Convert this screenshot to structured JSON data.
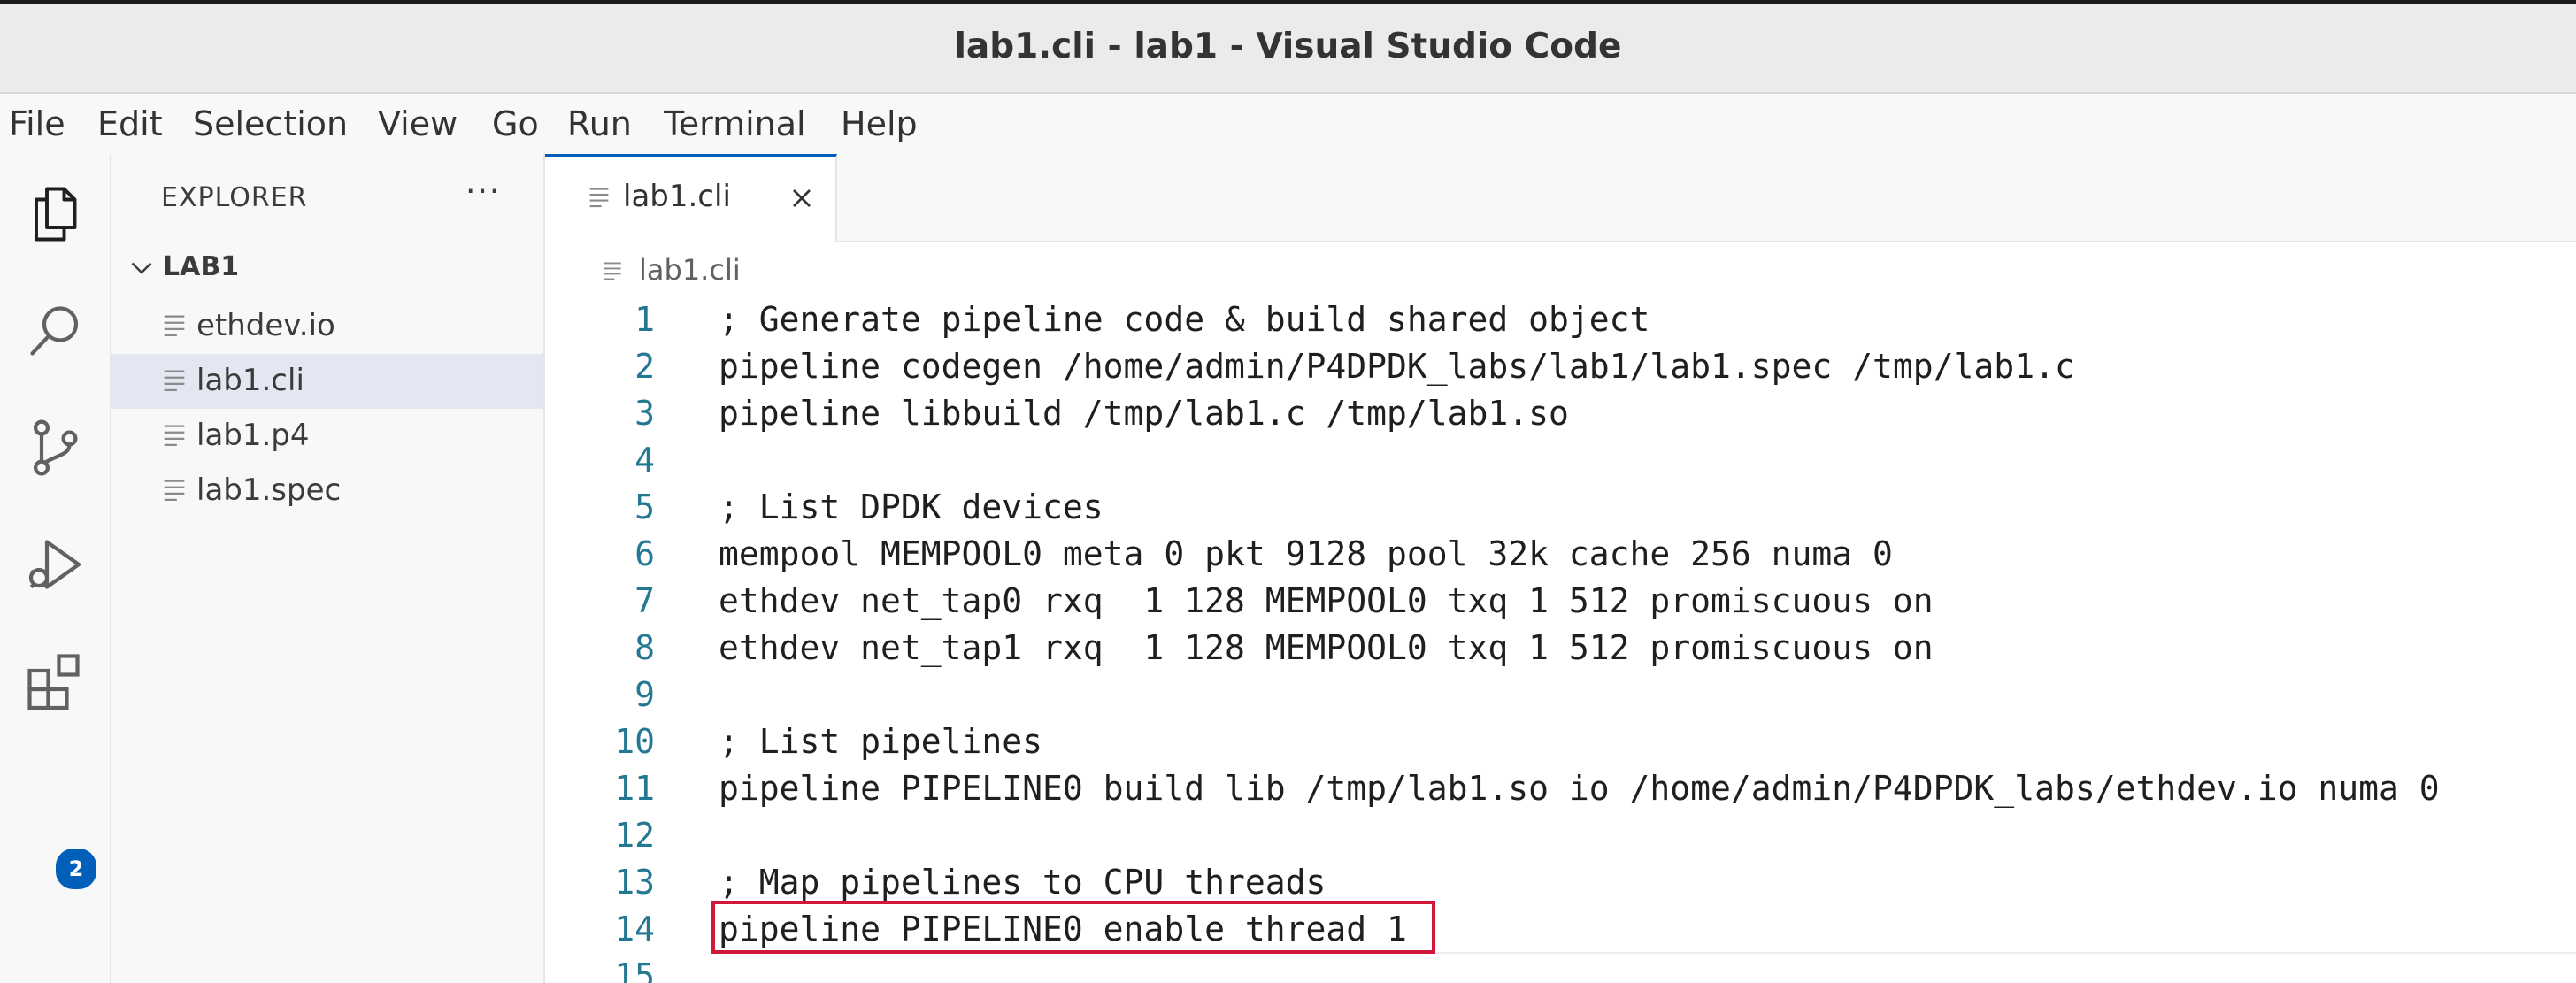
{
  "window": {
    "title": "lab1.cli - lab1 - Visual Studio Code"
  },
  "menu": [
    "File",
    "Edit",
    "Selection",
    "View",
    "Go",
    "Run",
    "Terminal",
    "Help"
  ],
  "activity_bar": {
    "icons": [
      "explorer-icon",
      "search-icon",
      "source-control-icon",
      "run-debug-icon",
      "extensions-icon"
    ],
    "extensions_badge": "2"
  },
  "sidebar": {
    "title": "EXPLORER",
    "more": "···",
    "folder": "LAB1",
    "files": [
      {
        "name": "ethdev.io",
        "active": false
      },
      {
        "name": "lab1.cli",
        "active": true
      },
      {
        "name": "lab1.p4",
        "active": false
      },
      {
        "name": "lab1.spec",
        "active": false
      }
    ]
  },
  "tabs": [
    {
      "label": "lab1.cli",
      "active": true
    }
  ],
  "breadcrumb": "lab1.cli",
  "editor": {
    "lines": [
      {
        "n": "1",
        "text": "; Generate pipeline code & build shared object"
      },
      {
        "n": "2",
        "text": "pipeline codegen /home/admin/P4DPDK_labs/lab1/lab1.spec /tmp/lab1.c"
      },
      {
        "n": "3",
        "text": "pipeline libbuild /tmp/lab1.c /tmp/lab1.so"
      },
      {
        "n": "4",
        "text": ""
      },
      {
        "n": "5",
        "text": "; List DPDK devices"
      },
      {
        "n": "6",
        "text": "mempool MEMPOOL0 meta 0 pkt 9128 pool 32k cache 256 numa 0"
      },
      {
        "n": "7",
        "text": "ethdev net_tap0 rxq  1 128 MEMPOOL0 txq 1 512 promiscuous on"
      },
      {
        "n": "8",
        "text": "ethdev net_tap1 rxq  1 128 MEMPOOL0 txq 1 512 promiscuous on"
      },
      {
        "n": "9",
        "text": ""
      },
      {
        "n": "10",
        "text": "; List pipelines"
      },
      {
        "n": "11",
        "text": "pipeline PIPELINE0 build lib /tmp/lab1.so io /home/admin/P4DPDK_labs/ethdev.io numa 0"
      },
      {
        "n": "12",
        "text": ""
      },
      {
        "n": "13",
        "text": "; Map pipelines to CPU threads"
      },
      {
        "n": "14",
        "text": "pipeline PIPELINE0 enable thread 1"
      },
      {
        "n": "15",
        "text": ""
      }
    ],
    "highlighted_line": "14"
  },
  "colors": {
    "accent": "#005fb8",
    "highlight_box": "#d0193a",
    "line_number": "#237893"
  }
}
